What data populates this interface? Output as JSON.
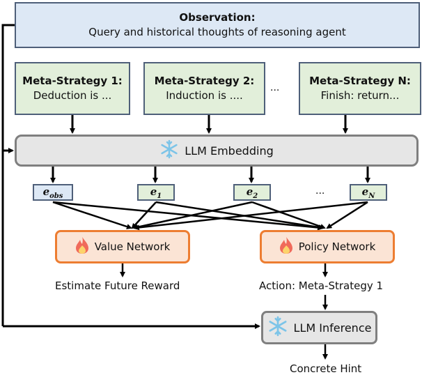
{
  "observation": {
    "title": "Observation:",
    "subtitle": "Query and historical thoughts of reasoning agent"
  },
  "meta_strategies": [
    {
      "title": "Meta-Strategy 1:",
      "desc": "Deduction is ..."
    },
    {
      "title": "Meta-Strategy 2:",
      "desc": "Induction is ...."
    },
    {
      "title": "Meta-Strategy N:",
      "desc": "Finish: return..."
    }
  ],
  "ellipsis": "...",
  "embedding": {
    "label": "LLM Embedding",
    "icon": "snowflake-icon"
  },
  "embeddings": [
    {
      "base": "e",
      "sub": "obs"
    },
    {
      "base": "e",
      "sub": "1"
    },
    {
      "base": "e",
      "sub": "2"
    },
    {
      "base": "e",
      "sub": "N"
    }
  ],
  "value_network": {
    "label": "Value Network",
    "icon": "fire-icon",
    "output": "Estimate Future Reward"
  },
  "policy_network": {
    "label": "Policy Network",
    "icon": "fire-icon",
    "output": "Action: Meta-Strategy 1"
  },
  "inference": {
    "label": "LLM Inference",
    "icon": "snowflake-icon",
    "output": "Concrete Hint"
  },
  "colors": {
    "observation_fill": "#dde8f5",
    "strategy_fill": "#e2efda",
    "frozen_fill": "#e6e6e6",
    "trainable_fill": "#fbe4d5",
    "trainable_border": "#ed7d31",
    "snowflake": "#7cc4e8"
  }
}
